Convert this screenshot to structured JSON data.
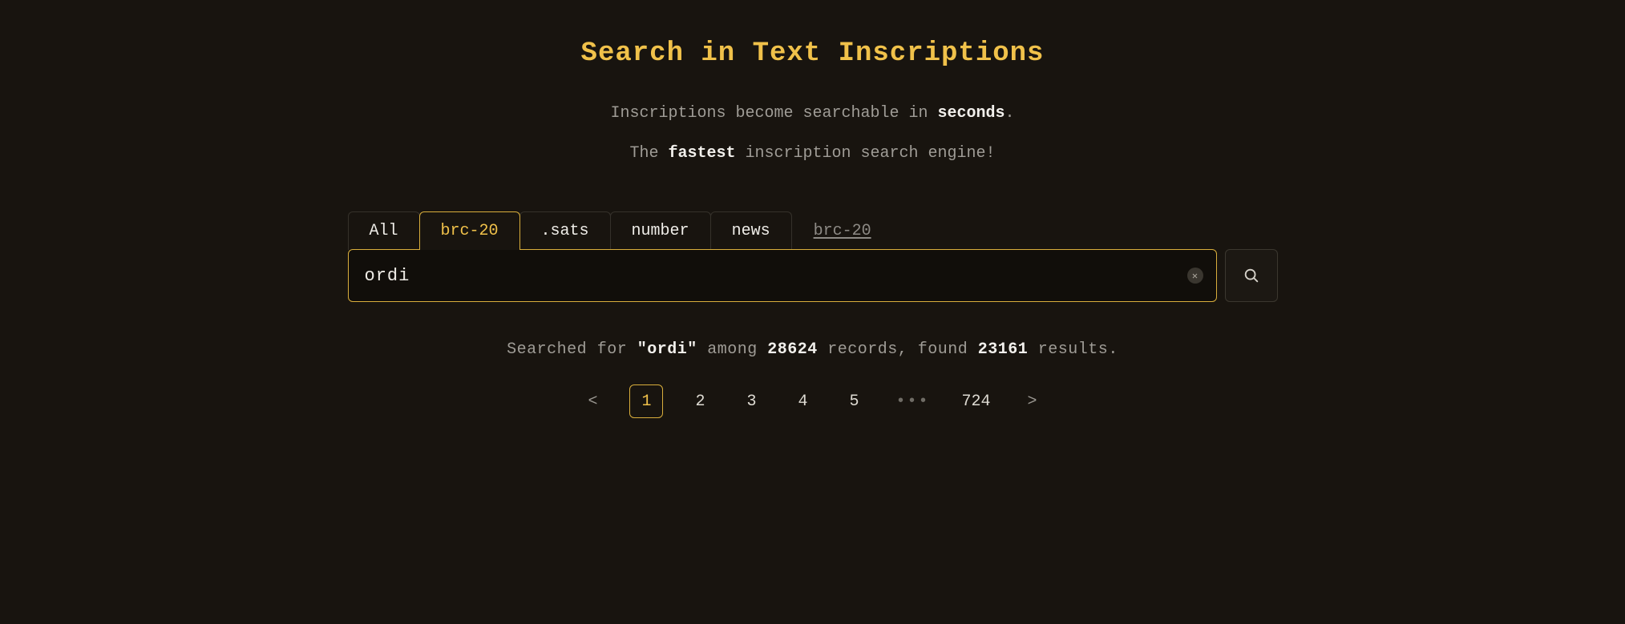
{
  "title": "Search in Text Inscriptions",
  "subtitle": {
    "line1_pre": "Inscriptions become searchable in ",
    "line1_bold": "seconds",
    "line1_post": ".",
    "line2_pre": "The ",
    "line2_bold": "fastest",
    "line2_post": " inscription search engine!"
  },
  "tabs": {
    "t0": "All",
    "t1": "brc-20",
    "t2": ".sats",
    "t3": "number",
    "t4": "news",
    "sublink": "brc-20"
  },
  "search": {
    "value": "ordi",
    "placeholder": ""
  },
  "status": {
    "pre": "Searched for ",
    "term": "\"ordi\"",
    "mid1": " among ",
    "total": "28624",
    "mid2": " records, found ",
    "found": "23161",
    "post": " results."
  },
  "pager": {
    "prev": "<",
    "p1": "1",
    "p2": "2",
    "p3": "3",
    "p4": "4",
    "p5": "5",
    "ellipsis": "•••",
    "last": "724",
    "next": ">"
  }
}
